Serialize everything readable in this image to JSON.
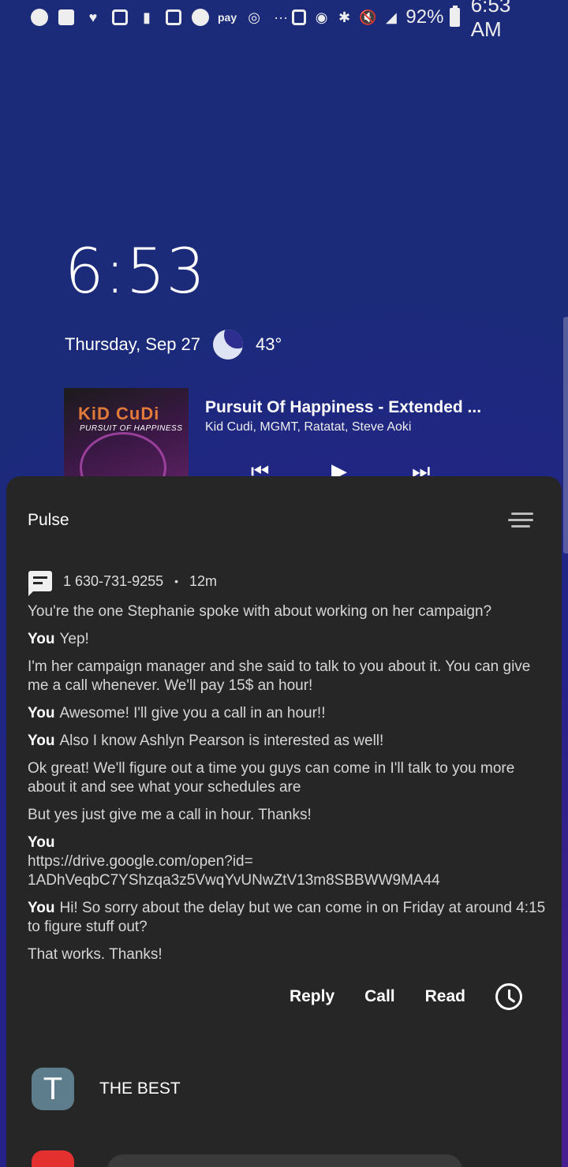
{
  "status_bar": {
    "left_icons": [
      "spotify-icon",
      "message-icon",
      "snapchat-icon",
      "instagram-icon",
      "pocket-icon",
      "bag-icon",
      "telegram-icon",
      "samsung-pay-icon",
      "nfc-icon",
      "more-icon"
    ],
    "pay_label": "pay",
    "more": "···",
    "right_icons": [
      "recycle-icon",
      "location-icon",
      "bluetooth-icon",
      "mute-icon",
      "signal-icon"
    ],
    "battery": "92%",
    "time": "6:53 AM"
  },
  "lockscreen": {
    "clock": "6:53",
    "date": "Thursday, Sep 27",
    "weather_icon": "moon-icon",
    "temperature": "43°"
  },
  "media": {
    "album_title": "KiD CuDi",
    "album_subtitle": "PURSUIT OF HAPPINESS",
    "track_title": "Pursuit Of Happiness - Extended ...",
    "artist": "Kid Cudi, MGMT, Ratatat, Steve Aoki",
    "controls": [
      "previous-icon",
      "play-icon",
      "next-icon"
    ]
  },
  "notification": {
    "app_name": "Pulse",
    "sender": "1 630-731-9255",
    "separator": "•",
    "time_ago": "12m",
    "messages": [
      {
        "you": "",
        "text": "You're the one Stephanie spoke with about working on her campaign?"
      },
      {
        "you": "You",
        "text": "Yep!"
      },
      {
        "you": "",
        "text": "I'm her campaign manager and she said to talk to you about it. You can give me a call whenever. We'll pay 15$ an hour!"
      },
      {
        "you": "You",
        "text": "Awesome! I'll give you a call in an hour!!"
      },
      {
        "you": "You",
        "text": "Also I know Ashlyn Pearson is interested as well!"
      },
      {
        "you": "",
        "text": "Ok great! We'll figure out a time you guys can come in I'll talk to you more about it and see what your schedules are"
      },
      {
        "you": "",
        "text": "But yes just give me a call in hour. Thanks!"
      },
      {
        "you": "You",
        "text": "https://drive.google.com/open?id=\n1ADhVeqbC7YShzqa3z5VwqYvUNwZtV13m8SBBWW9MA44",
        "block": true
      },
      {
        "you": "You",
        "text": "Hi! So sorry about the delay but we can come in on Friday at around 4:15 to figure stuff out?"
      },
      {
        "you": "",
        "text": "That works. Thanks!"
      }
    ],
    "actions": {
      "reply": "Reply",
      "call": "Call",
      "read": "Read"
    }
  },
  "group": {
    "avatar_letter": "T",
    "name": "THE BEST"
  }
}
